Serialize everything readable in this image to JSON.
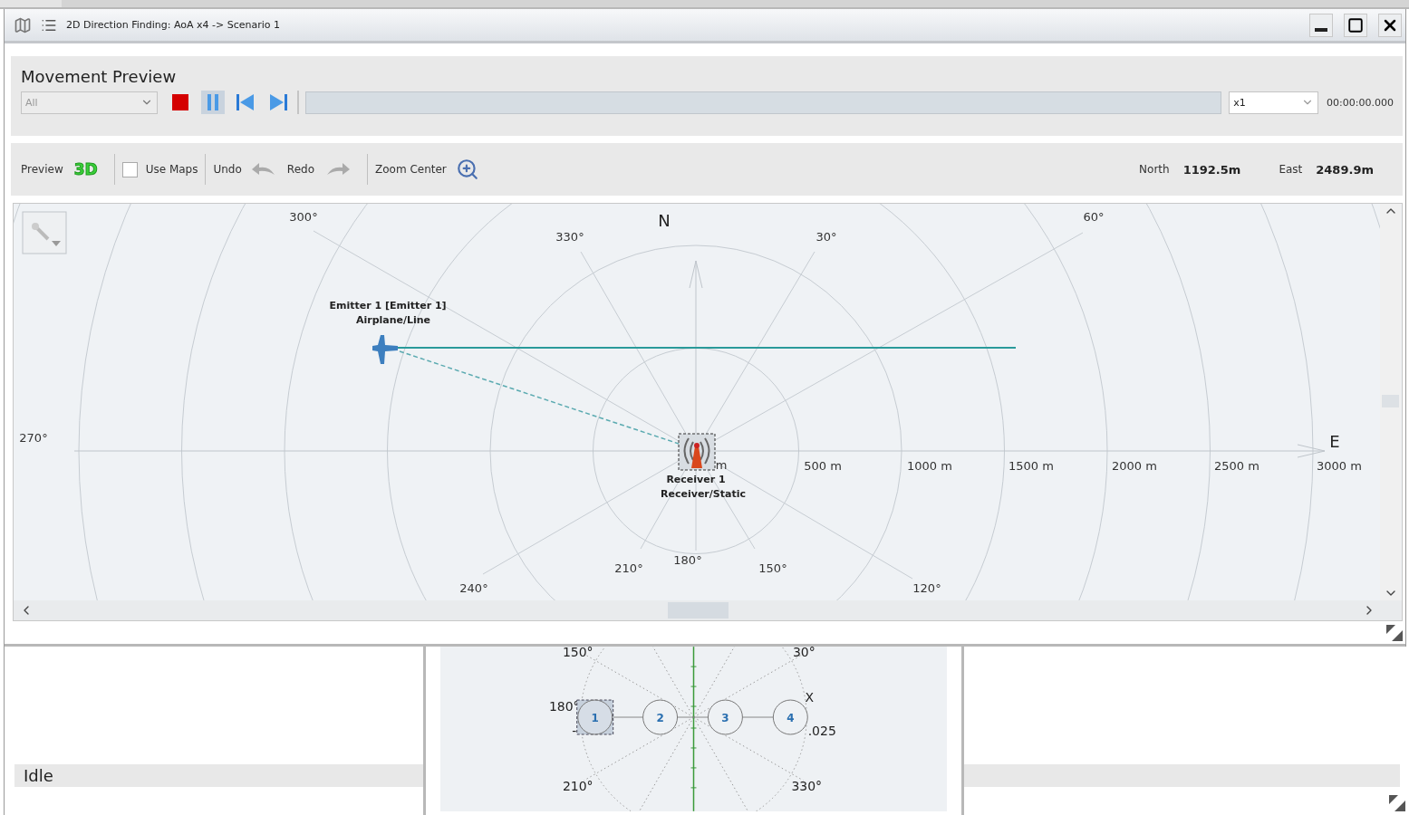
{
  "window": {
    "title": "2D Direction Finding: AoA x4 -> Scenario 1"
  },
  "movement_preview": {
    "title": "Movement Preview",
    "filter": {
      "value": "All"
    },
    "progress": {
      "level": 0
    },
    "speed": {
      "value": "x1"
    },
    "time": "00:00:00.000"
  },
  "toolbar": {
    "preview_label": "Preview",
    "preview_3d": "3D",
    "use_maps": {
      "label": "Use Maps",
      "checked": false
    },
    "undo": "Undo",
    "redo": "Redo",
    "zoom_center": "Zoom Center",
    "north": {
      "label": "North",
      "value": "1192.5m"
    },
    "east": {
      "label": "East",
      "value": "2489.9m"
    }
  },
  "map": {
    "axis_labels": [
      "N",
      "E"
    ],
    "angle_labels": [
      "300°",
      "330°",
      "30°",
      "60°",
      "270°",
      "240°",
      "210°",
      "180°",
      "150°",
      "120°"
    ],
    "range_labels": [
      "m",
      "500 m",
      "1000 m",
      "1500 m",
      "2000 m",
      "2500 m",
      "3000 m"
    ],
    "emitter": {
      "name": "Emitter 1 [Emitter 1]",
      "type": "Airplane/Line"
    },
    "receiver": {
      "name": "Receiver 1",
      "type": "Receiver/Static"
    }
  },
  "antenna_plot": {
    "labels": [
      "150°",
      "30°",
      "X",
      "180°",
      "-",
      ".025",
      "210°",
      "330°"
    ],
    "elements": [
      {
        "label": "1",
        "selected": true
      },
      {
        "label": "2",
        "selected": false
      },
      {
        "label": "3",
        "selected": false
      },
      {
        "label": "4",
        "selected": false
      }
    ]
  },
  "status": {
    "text": "Idle"
  }
}
